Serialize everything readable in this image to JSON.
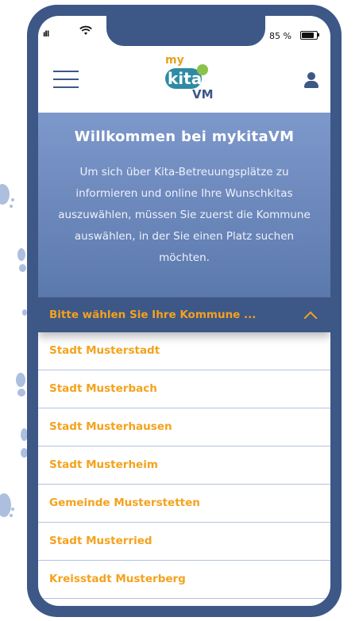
{
  "status_bar": {
    "signal": "ıll",
    "battery_percent": "85 %",
    "battery_level": 0.85
  },
  "header": {
    "menu_icon": "hamburger-menu-icon",
    "logo": {
      "my": "my",
      "kita": "kita",
      "vm": "VM"
    },
    "user_icon": "user-icon"
  },
  "hero": {
    "title": "Willkommen bei mykitaVM",
    "text": "Um sich über Kita-Betreuungsplätze zu informieren und online Ihre Wunschkitas auszuwählen, müssen Sie zuerst die Kommune auswählen, in der Sie einen Platz suchen möchten."
  },
  "dropdown": {
    "label": "Bitte wählen Sie Ihre Kommune ...",
    "icon": "chevron-up-icon",
    "expanded": true
  },
  "communes": [
    "Stadt Musterstadt",
    "Stadt Musterbach",
    "Stadt Musterhausen",
    "Stadt Musterheim",
    "Gemeinde Musterstetten",
    "Stadt Musterried",
    "Kreisstadt Musterberg"
  ],
  "colors": {
    "frame": "#3d5787",
    "accent": "#f4a21d",
    "hero": "#6c87bb"
  }
}
